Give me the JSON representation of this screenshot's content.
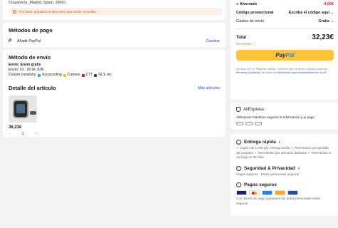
{
  "address": {
    "line": "Chapinería, Madrid, Spain, 28001",
    "warning": "Por favor, actualiza tu dirección para recibir el pedido"
  },
  "payment": {
    "title": "Métodos de pago",
    "method": "Añadir PayPal",
    "change": "Cambiar"
  },
  "shipping": {
    "title": "Método de envío",
    "type": "Envío: Envío gratis",
    "dates": "Envío: 23 - 26 de JUN",
    "courier_prefix": "Courier company:",
    "couriers": [
      "Ecoscooting",
      "Correos",
      "CTT",
      "GLS",
      "etc."
    ]
  },
  "items": {
    "title": "Detalle del artículo",
    "more": "Más artículos",
    "price": "36,23€",
    "qty": "1",
    "minus": "−",
    "plus": "+"
  },
  "summary": {
    "saved_label": "Ahorrado",
    "saved_value": "-4,00€",
    "promo_label": "Código promocional",
    "promo_value": "Escribe el código aquí",
    "ship_label": "Gastos de envío",
    "ship_value": "Gratis",
    "total_label": "Total",
    "total_value": "32,23€",
    "iva": "IVA incluido",
    "pp_pay": "Pay",
    "pp_pal": "Pal",
    "legal_1": "Al hacer clic en 'Realizar pedido', confirmo que he leído y acepto todos los ",
    "legal_link1": "términos y políticas",
    "legal_2": ", así como la ",
    "legal_link2": "Información para consumidores en la UE",
    "legal_3": "."
  },
  "trust": {
    "brand": "AliExpress",
    "text": "AliExpress mantiene seguros tu información y tu pago"
  },
  "info": {
    "fast_title": "Entrega rápida",
    "fast_body": "✓ Cupón de 1,00€ por entrega tardía  ✓ Reembolso por pérdida del paquete  ✓ Reembolso por artículos dañados  ✓ Reembolso si no llega en 35 días",
    "sec_title": "Seguridad & Privacidad",
    "sec_body": "Pagos seguros · Datos personales seguros",
    "pay_title": "Pagos seguros",
    "pay_body": "Con socios de pago populares tus datos personales están seguros"
  },
  "colors": {
    "accent": "#e02020",
    "link": "#1f55d1",
    "paypal_yellow": "#ffc439"
  }
}
